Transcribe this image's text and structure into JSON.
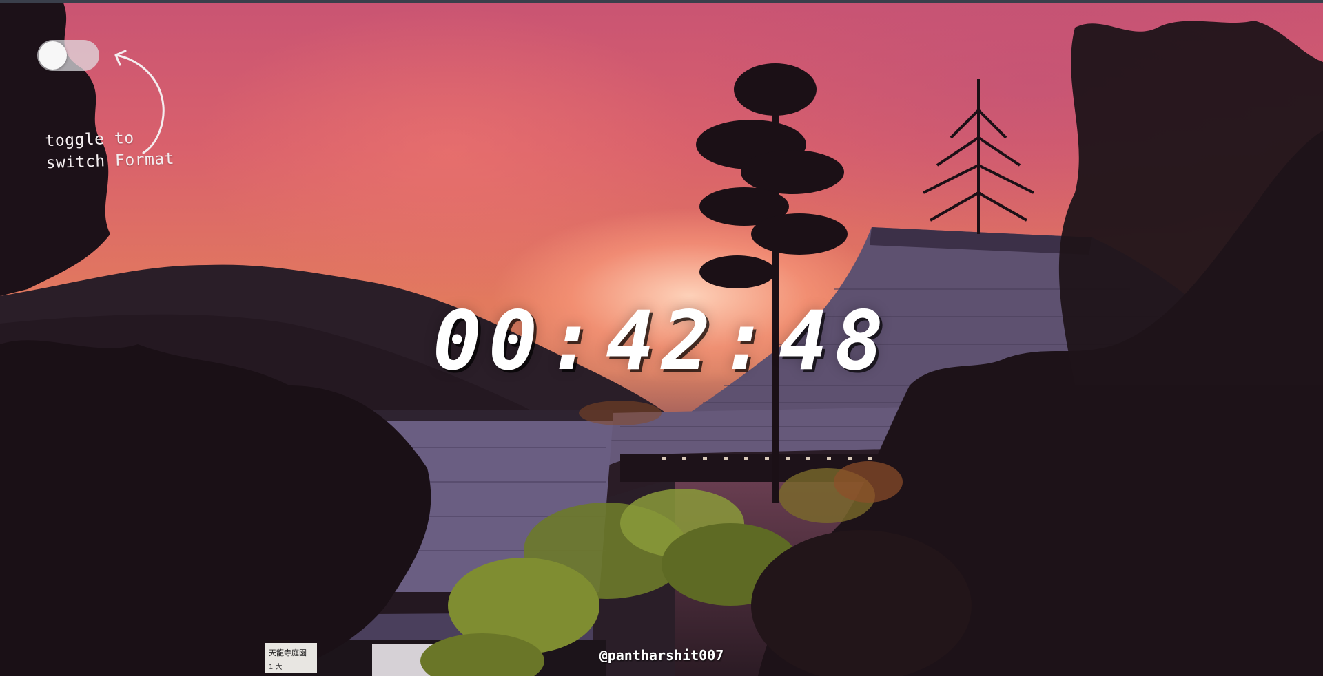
{
  "toggle": {
    "on": false
  },
  "hint": {
    "line1": "toggle to",
    "line2": "switch Format"
  },
  "clock": {
    "hours": "00",
    "minutes": "42",
    "seconds": "48",
    "separator": ":"
  },
  "credit": {
    "handle": "@pantharshit007"
  },
  "background": {
    "scene": "sunset over japanese temple roofs with tree silhouettes"
  },
  "colors": {
    "text": "#ffffff",
    "toggle_track": "#e1e1e4",
    "toggle_knob": "#f7f7f7"
  },
  "signs": {
    "line1": "天龍寺庭園",
    "line2": "1 大"
  }
}
